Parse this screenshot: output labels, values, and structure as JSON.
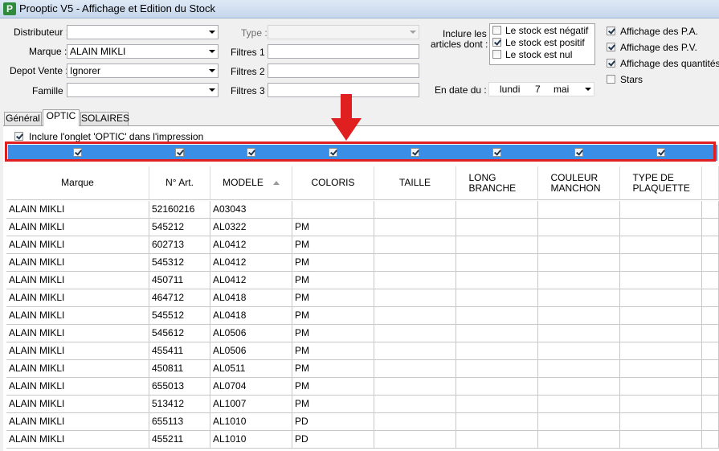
{
  "window": {
    "title": "Prooptic V5 - Affichage et Edition du Stock",
    "icon_letter": "P"
  },
  "filters": {
    "distributeur_label": "Distributeur :",
    "distributeur_value": "",
    "marque_label": "Marque :",
    "marque_value": "ALAIN MIKLI",
    "depot_label": "Depot Vente :",
    "depot_value": "Ignorer",
    "famille_label": "Famille :",
    "famille_value": "",
    "type_label": "Type :",
    "type_value": "",
    "filtre1_label": "Filtres 1 :",
    "filtre2_label": "Filtres 2 :",
    "filtre3_label": "Filtres 3 :"
  },
  "inclure": {
    "label_line1": "Inclure les",
    "label_line2": "articles dont :",
    "options": [
      {
        "label": "Le stock est négatif",
        "checked": false
      },
      {
        "label": "Le stock est positif",
        "checked": true
      },
      {
        "label": "Le stock est nul",
        "checked": false
      }
    ]
  },
  "date": {
    "label": "En date du :",
    "day_name": "lundi",
    "day": "7",
    "month": "mai"
  },
  "display_options": [
    {
      "label": "Affichage des P.A.",
      "checked": true
    },
    {
      "label": "Affichage des P.V.",
      "checked": true
    },
    {
      "label": "Affichage des quantités",
      "checked": true
    },
    {
      "label": "Stars",
      "checked": false
    }
  ],
  "tabs": [
    {
      "label": "Général",
      "active": false
    },
    {
      "label": "OPTIC",
      "active": true
    },
    {
      "label": "SOLAIRES",
      "active": false
    }
  ],
  "print_option": {
    "label": "Inclure l'onglet 'OPTIC' dans l'impression",
    "checked": true
  },
  "accent_colors": {
    "checkbar": "#3a8ee6",
    "highlight_frame": "#e02020"
  },
  "grid": {
    "columns": [
      "Marque",
      "N° Art.",
      "MODELE",
      "COLORIS",
      "TAILLE",
      "LONG BRANCHE",
      "COULEUR MANCHON",
      "TYPE DE PLAQUETTE"
    ],
    "sorted_column": "MODELE",
    "rows": [
      [
        "ALAIN MIKLI",
        "52160216",
        "A03043",
        ""
      ],
      [
        "ALAIN MIKLI",
        "545212",
        "AL0322",
        "PM"
      ],
      [
        "ALAIN MIKLI",
        "602713",
        "AL0412",
        "PM"
      ],
      [
        "ALAIN MIKLI",
        "545312",
        "AL0412",
        "PM"
      ],
      [
        "ALAIN MIKLI",
        "450711",
        "AL0412",
        "PM"
      ],
      [
        "ALAIN MIKLI",
        "464712",
        "AL0418",
        "PM"
      ],
      [
        "ALAIN MIKLI",
        "545512",
        "AL0418",
        "PM"
      ],
      [
        "ALAIN MIKLI",
        "545612",
        "AL0506",
        "PM"
      ],
      [
        "ALAIN MIKLI",
        "455411",
        "AL0506",
        "PM"
      ],
      [
        "ALAIN MIKLI",
        "450811",
        "AL0511",
        "PM"
      ],
      [
        "ALAIN MIKLI",
        "655013",
        "AL0704",
        "PM"
      ],
      [
        "ALAIN MIKLI",
        "513412",
        "AL1007",
        "PM"
      ],
      [
        "ALAIN MIKLI",
        "655113",
        "AL1010",
        "PD"
      ],
      [
        "ALAIN MIKLI",
        "455211",
        "AL1010",
        "PD"
      ]
    ]
  }
}
